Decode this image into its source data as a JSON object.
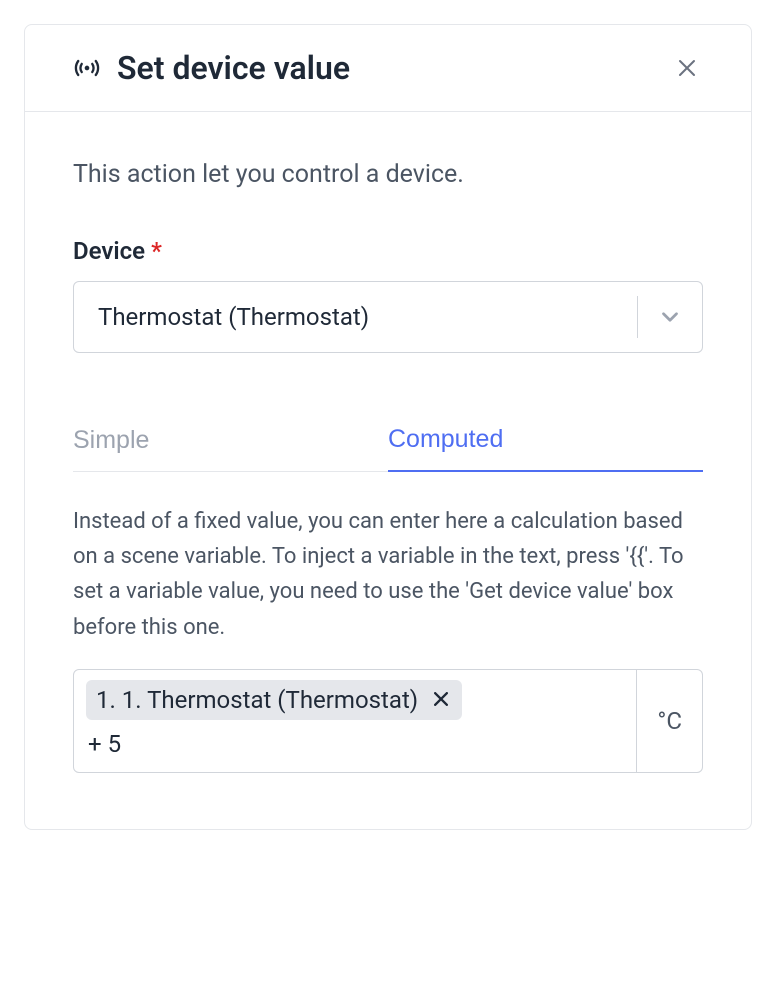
{
  "header": {
    "title": "Set device value"
  },
  "description": "This action let you control a device.",
  "deviceField": {
    "label": "Device",
    "requiredMark": "*",
    "selectedValue": "Thermostat (Thermostat)"
  },
  "tabs": {
    "simple": "Simple",
    "computed": "Computed"
  },
  "computedSection": {
    "helpText": "Instead of a fixed value, you can enter here a calculation based on a scene variable. To inject a variable in the text, press '{{'. To set a variable value, you need to use the 'Get device value' box before this one.",
    "variableChip": "1. 1. Thermostat (Thermostat)",
    "expression": "+ 5",
    "unit": "°C"
  }
}
